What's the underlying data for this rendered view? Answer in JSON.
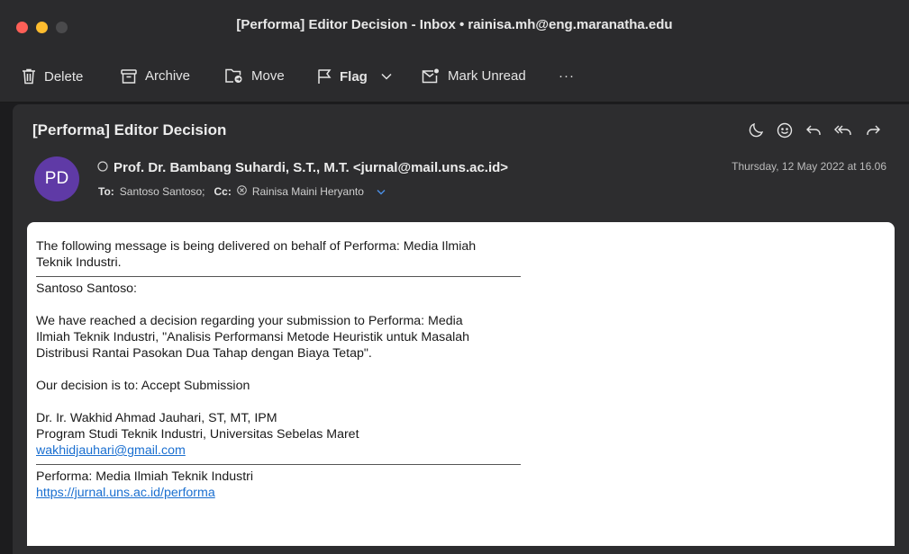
{
  "window": {
    "title": "[Performa] Editor Decision - Inbox • rainisa.mh@eng.maranatha.edu"
  },
  "toolbar": {
    "delete_label": "Delete",
    "archive_label": "Archive",
    "move_label": "Move",
    "flag_label": "Flag",
    "mark_unread_label": "Mark Unread",
    "more_label": "···"
  },
  "message": {
    "subject": "[Performa] Editor Decision",
    "avatar_initials": "PD",
    "from": "Prof. Dr. Bambang Suhardi, S.T., M.T. <jurnal@mail.uns.ac.id>",
    "to_label": "To:",
    "to": "Santoso Santoso;",
    "cc_label": "Cc:",
    "cc": "Rainisa Maini Heryanto",
    "date": "Thursday, 12 May 2022 at 16.06"
  },
  "email_body": {
    "intro_line1": "The following message is being delivered on behalf of Performa: Media Ilmiah",
    "intro_line2": "Teknik Industri.",
    "salutation": "Santoso Santoso:",
    "para_line1": "We have reached a decision regarding your submission to Performa: Media",
    "para_line2": "Ilmiah Teknik Industri, \"Analisis Performansi Metode Heuristik untuk Masalah",
    "para_line3": "Distribusi Rantai Pasokan Dua Tahap dengan Biaya Tetap\".",
    "decision": "Our decision is to: Accept Submission",
    "sig_name": "Dr. Ir. Wakhid Ahmad Jauhari, ST,  MT, IPM",
    "sig_affil": "Program Studi Teknik Industri, Universitas Sebelas Maret",
    "sig_email": "wakhidjauhari@gmail.com",
    "footer_name": "Performa: Media Ilmiah Teknik Industri",
    "footer_url": "https://jurnal.uns.ac.id/performa"
  },
  "colors": {
    "avatar_bg": "#5f3aa6",
    "link": "#1a6fd0",
    "close_light": "#fe5f57",
    "minimize_light": "#febc2e",
    "zoom_light": "#4a4a4c"
  }
}
